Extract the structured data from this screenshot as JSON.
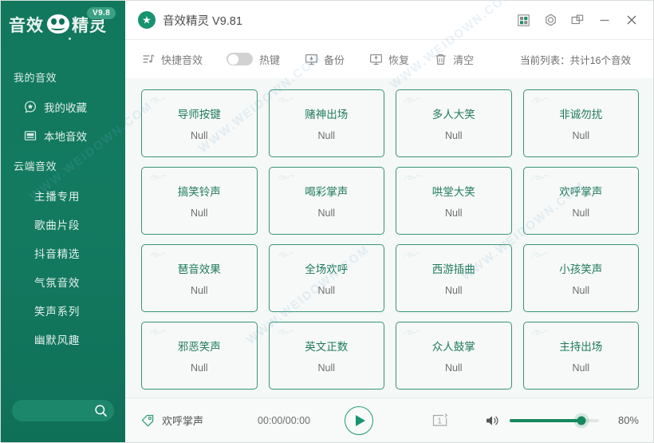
{
  "sidebar": {
    "logo": {
      "text_left": "音效",
      "text_right": "精灵",
      "version_badge": "V9.8",
      "icon": "smiley-face-logo"
    },
    "sections": [
      {
        "title": "我的音效",
        "items": [
          {
            "label": "我的收藏",
            "icon": "star-badge-icon"
          },
          {
            "label": "本地音效",
            "icon": "folder-window-icon"
          }
        ]
      },
      {
        "title": "云端音效",
        "items": [
          {
            "label": "主播专用",
            "icon": ""
          },
          {
            "label": "歌曲片段",
            "icon": ""
          },
          {
            "label": "抖音精选",
            "icon": ""
          },
          {
            "label": "气氛音效",
            "icon": ""
          },
          {
            "label": "笑声系列",
            "icon": ""
          },
          {
            "label": "幽默风趣",
            "icon": ""
          }
        ]
      }
    ],
    "search": {
      "value": "",
      "placeholder": "",
      "icon": "search-icon"
    },
    "colors": {
      "background": "#137a60",
      "text": "#e3f1ec",
      "search_bg": "#1d876b"
    }
  },
  "titlebar": {
    "app_icon": "app-star-icon",
    "title": "音效精灵 V9.81",
    "buttons": [
      {
        "name": "layout-icon",
        "label": ""
      },
      {
        "name": "settings-gear-icon",
        "label": ""
      },
      {
        "name": "restore-window-icon",
        "label": ""
      },
      {
        "name": "minimize-icon",
        "label": ""
      },
      {
        "name": "close-icon",
        "label": ""
      }
    ]
  },
  "toolbar": {
    "quick_effects_label": "快捷音效",
    "quick_effects_icon": "list-music-icon",
    "hotkey_label": "热键",
    "hotkey_enabled": false,
    "backup_label": "备份",
    "backup_icon": "monitor-download-icon",
    "restore_label": "恢复",
    "restore_icon": "monitor-upload-icon",
    "clear_label": "清空",
    "clear_icon": "trash-icon",
    "count_text": "当前列表：共计16个音效"
  },
  "grid": {
    "subtitle_value": "Null",
    "cards": [
      {
        "name": "导师按键",
        "sub": "Null"
      },
      {
        "name": "赌神出场",
        "sub": "Null"
      },
      {
        "name": "多人大笑",
        "sub": "Null"
      },
      {
        "name": "非诚勿扰",
        "sub": "Null"
      },
      {
        "name": "搞笑铃声",
        "sub": "Null"
      },
      {
        "name": "喝彩掌声",
        "sub": "Null"
      },
      {
        "name": "哄堂大笑",
        "sub": "Null"
      },
      {
        "name": "欢呼掌声",
        "sub": "Null"
      },
      {
        "name": "琶音效果",
        "sub": "Null"
      },
      {
        "name": "全场欢呼",
        "sub": "Null"
      },
      {
        "name": "西游插曲",
        "sub": "Null"
      },
      {
        "name": "小孩笑声",
        "sub": "Null"
      },
      {
        "name": "邪恶笑声",
        "sub": "Null"
      },
      {
        "name": "英文正数",
        "sub": "Null"
      },
      {
        "name": "众人鼓掌",
        "sub": "Null"
      },
      {
        "name": "主持出场",
        "sub": "Null"
      }
    ],
    "colors": {
      "background": "#f4f8f6",
      "card_bg": "#f7f9f8",
      "card_border": "#3a9377",
      "card_title": "#1f7a5e"
    }
  },
  "player": {
    "now_playing_icon": "sound-tag-icon",
    "now_playing": "欢呼掌声",
    "time": "00:00/00:00",
    "play_icon": "play-icon",
    "repeat_label": "1",
    "repeat_icon": "repeat-one-icon",
    "volume_icon": "volume-icon",
    "volume_percent": "80%",
    "volume_value": 80,
    "colors": {
      "accent": "#17885f",
      "play_ring": "#1f9a74"
    }
  },
  "watermarks": [
    "WWW.WEIDOWN.COM",
    "WWW.WEIDOWN.COM",
    "WWW.WEIDOWN.COM",
    "WWW.WEIDOWN.COM",
    "WWW.WEIDOWN.COM"
  ]
}
